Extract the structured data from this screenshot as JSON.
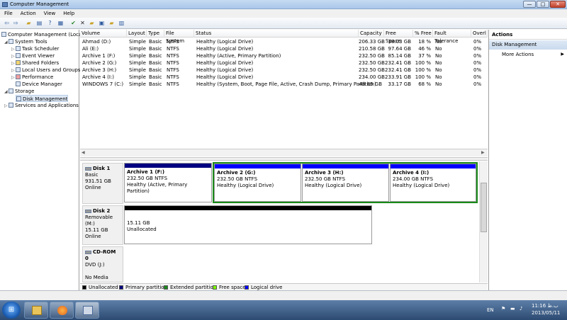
{
  "window": {
    "title": "Computer Management"
  },
  "window_buttons": {
    "minimize": "—",
    "maximize": "□",
    "close": "✕"
  },
  "menu": [
    "File",
    "Action",
    "View",
    "Help"
  ],
  "toolbar_icons": [
    "back-arrow-icon",
    "forward-arrow-icon",
    "up-folder-icon",
    "show-hide-tree-icon",
    "help-icon",
    "properties-icon",
    "checkmark-icon",
    "delete-icon",
    "open-icon",
    "export-icon",
    "refresh-icon",
    "view-icon"
  ],
  "tree": {
    "root": "Computer Management (Local",
    "system_tools": "System Tools",
    "task_scheduler": "Task Scheduler",
    "event_viewer": "Event Viewer",
    "shared_folders": "Shared Folders",
    "local_users": "Local Users and Groups",
    "performance": "Performance",
    "device_manager": "Device Manager",
    "storage": "Storage",
    "disk_management": "Disk Management",
    "services": "Services and Applications"
  },
  "volumes": {
    "columns": [
      "Volume",
      "Layout",
      "Type",
      "File System",
      "Status",
      "Capacity",
      "Free Space",
      "% Free",
      "Fault Tolerance",
      "Overl"
    ],
    "rows": [
      [
        "Ahmad (D:)",
        "Simple",
        "Basic",
        "NTFS",
        "Healthy (Logical Drive)",
        "206.33 GB",
        "38.03 GB",
        "18 %",
        "No",
        "0%"
      ],
      [
        "Ali (E:)",
        "Simple",
        "Basic",
        "NTFS",
        "Healthy (Logical Drive)",
        "210.58 GB",
        "97.64 GB",
        "46 %",
        "No",
        "0%"
      ],
      [
        "Archive 1 (F:)",
        "Simple",
        "Basic",
        "NTFS",
        "Healthy (Active, Primary Partition)",
        "232.50 GB",
        "85.14 GB",
        "37 %",
        "No",
        "0%"
      ],
      [
        "Archive 2 (G:)",
        "Simple",
        "Basic",
        "NTFS",
        "Healthy (Logical Drive)",
        "232.50 GB",
        "232.41 GB",
        "100 %",
        "No",
        "0%"
      ],
      [
        "Archive 3 (H:)",
        "Simple",
        "Basic",
        "NTFS",
        "Healthy (Logical Drive)",
        "232.50 GB",
        "232.41 GB",
        "100 %",
        "No",
        "0%"
      ],
      [
        "Archive 4 (I:)",
        "Simple",
        "Basic",
        "NTFS",
        "Healthy (Logical Drive)",
        "234.00 GB",
        "233.91 GB",
        "100 %",
        "No",
        "0%"
      ],
      [
        "WINDOWS 7 (C:)",
        "Simple",
        "Basic",
        "NTFS",
        "Healthy (System, Boot, Page File, Active, Crash Dump, Primary Partition)",
        "48.85 GB",
        "33.17 GB",
        "68 %",
        "No",
        "0%"
      ]
    ]
  },
  "disks": {
    "disk1": {
      "name": "Disk 1",
      "type": "Basic",
      "size": "931.51 GB",
      "status": "Online",
      "partitions": [
        {
          "name": "Archive 1  (F:)",
          "size": "232.50 GB NTFS",
          "status": "Healthy (Active, Primary Partition)"
        },
        {
          "name": "Archive 2  (G:)",
          "size": "232.50 GB NTFS",
          "status": "Healthy (Logical Drive)"
        },
        {
          "name": "Archive 3  (H:)",
          "size": "232.50 GB NTFS",
          "status": "Healthy (Logical Drive)"
        },
        {
          "name": "Archive 4  (I:)",
          "size": "234.00 GB NTFS",
          "status": "Healthy (Logical Drive)"
        }
      ]
    },
    "disk2": {
      "name": "Disk 2",
      "type": "Removable (M:)",
      "size": "15.11 GB",
      "status": "Online",
      "partition": {
        "size": "15.11 GB",
        "status": "Unallocated"
      }
    },
    "cdrom": {
      "name": "CD-ROM 0",
      "type": "DVD (J:)",
      "media": "No Media"
    }
  },
  "legend": [
    {
      "label": "Unallocated",
      "color": "#000000"
    },
    {
      "label": "Primary partition",
      "color": "#000080"
    },
    {
      "label": "Extended partition",
      "color": "#1a8a1a"
    },
    {
      "label": "Free space",
      "color": "#7cfc00"
    },
    {
      "label": "Logical drive",
      "color": "#0000ff"
    }
  ],
  "actions": {
    "header": "Actions",
    "section": "Disk Management",
    "more": "More Actions"
  },
  "taskbar": {
    "lang": "EN",
    "time": "11:16 ب.ظ",
    "date": "2013/05/11"
  }
}
